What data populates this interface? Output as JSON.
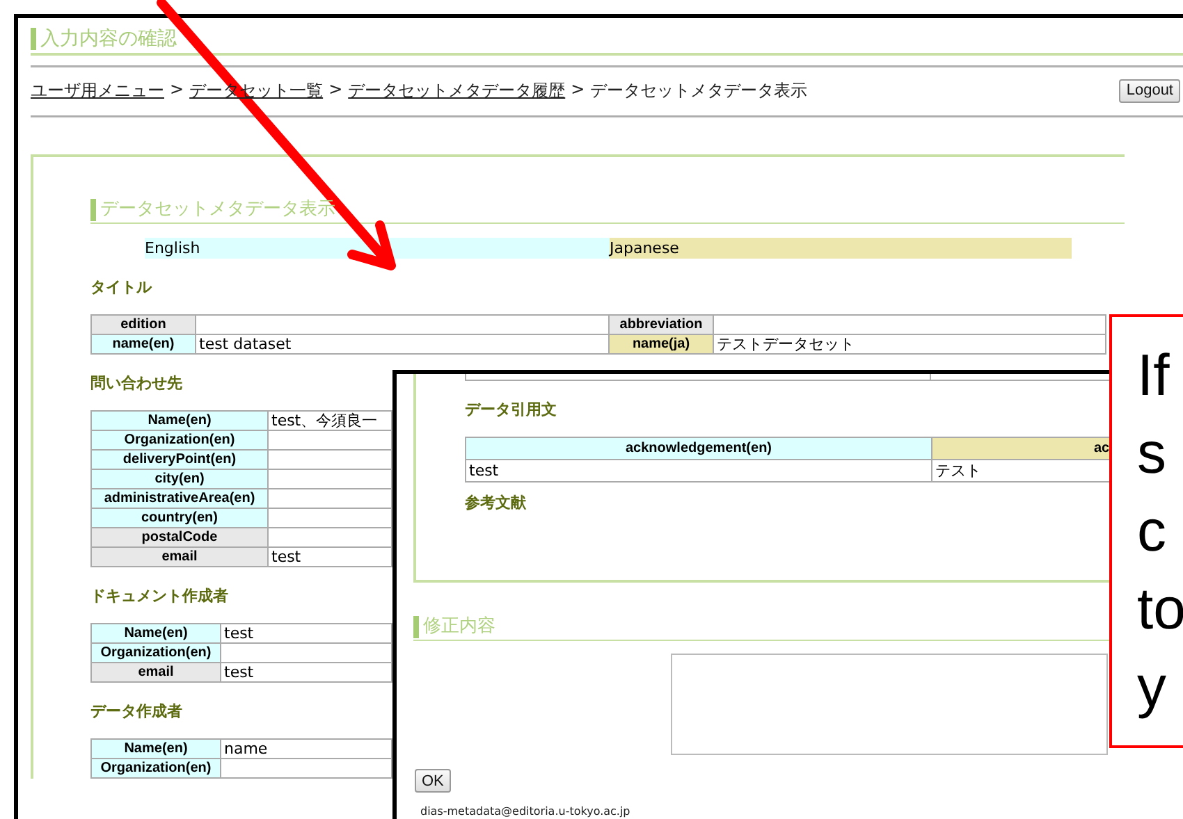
{
  "page_title": "入力内容の確認",
  "breadcrumb": [
    {
      "label": "ユーザ用メニュー",
      "link": true
    },
    {
      "label": "データセット一覧",
      "link": true
    },
    {
      "label": "データセットメタデータ履歴",
      "link": true
    },
    {
      "label": "データセットメタデータ表示",
      "link": false
    }
  ],
  "breadcrumb_separator": ">",
  "logout_button": "Logout",
  "section_title": "データセットメタデータ表示",
  "legend": [
    {
      "label": "English",
      "color": "#dcffff"
    },
    {
      "label": "Japanese",
      "color": "#ede6ad"
    }
  ],
  "title_section": {
    "heading": "タイトル",
    "rows": [
      [
        {
          "kind": "label",
          "text": "edition",
          "color": "#e8e8e8"
        },
        {
          "kind": "value"
        },
        {
          "kind": "label",
          "text": "abbreviation",
          "color": "#e8e8e8"
        },
        {
          "kind": "value"
        }
      ],
      [
        {
          "kind": "label",
          "text": "name(en)",
          "color": "#dcffff"
        },
        {
          "kind": "value",
          "text": "test dataset"
        },
        {
          "kind": "label",
          "text": "name(ja)",
          "color": "#ede6ad"
        },
        {
          "kind": "value",
          "text": "テストデータセット"
        }
      ]
    ]
  },
  "contacts": [
    {
      "heading": "問い合わせ先",
      "rows": [
        {
          "label": "Name(en)",
          "color": "#dcffff",
          "value": "test、今須良一"
        },
        {
          "label": "Organization(en)",
          "color": "#dcffff"
        },
        {
          "label": "deliveryPoint(en)",
          "color": "#dcffff"
        },
        {
          "label": "city(en)",
          "color": "#dcffff"
        },
        {
          "label": "administrativeArea(en)",
          "color": "#dcffff"
        },
        {
          "label": "country(en)",
          "color": "#dcffff"
        },
        {
          "label": "postalCode",
          "color": "#e8e8e8"
        },
        {
          "label": "email",
          "color": "#e8e8e8",
          "value": "test"
        }
      ]
    },
    {
      "heading": "ドキュメント作成者",
      "rows": [
        {
          "label": "Name(en)",
          "color": "#dcffff",
          "value": "test"
        },
        {
          "label": "Organization(en)",
          "color": "#dcffff"
        },
        {
          "label": "email",
          "color": "#e8e8e8",
          "value": "test"
        }
      ]
    },
    {
      "heading": "データ作成者",
      "rows": [
        {
          "label": "Name(en)",
          "color": "#dcffff",
          "value": "name"
        },
        {
          "label": "Organization(en)",
          "color": "#dcffff"
        }
      ]
    }
  ],
  "overlay": {
    "citation": {
      "heading": "データ引用文",
      "columns": [
        {
          "label": "acknowledgement(en)",
          "color": "#dcffff"
        },
        {
          "label": "ac",
          "color": "#ede6ad"
        }
      ],
      "rows": [
        [
          "test",
          "テスト"
        ]
      ]
    },
    "references_heading": "参考文献",
    "revision_heading": "修正内容",
    "ok_button": "OK",
    "footer_email": "dias-metadata@editoria.u-tokyo.ac.jp"
  },
  "callout": {
    "lines": [
      "If",
      "s",
      "c",
      "to",
      "y"
    ]
  }
}
